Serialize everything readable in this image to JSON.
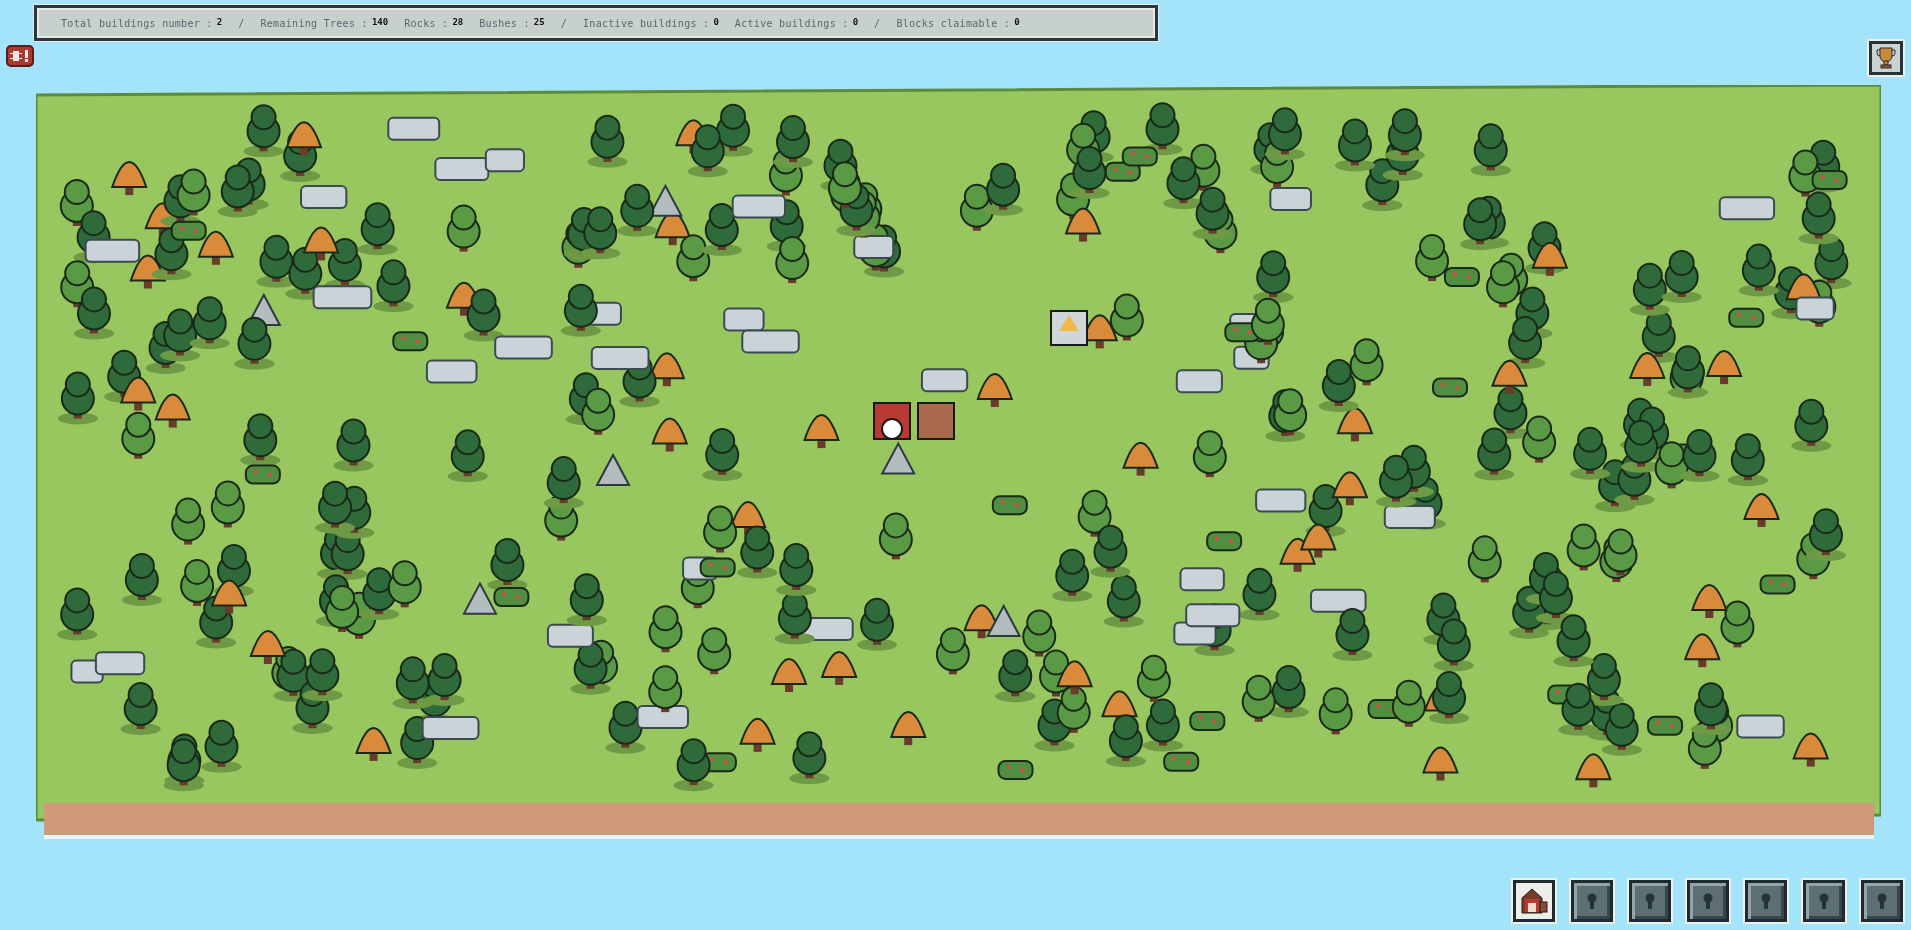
{
  "stats_bar": [
    {
      "label": "Total buildings number :",
      "value": "2"
    },
    {
      "label": "Remaining Trees :",
      "value": "140",
      "separator": "/"
    },
    {
      "label": "Rocks :",
      "value": "28"
    },
    {
      "label": "Bushes :",
      "value": "25"
    },
    {
      "label": "Inactive buildings :",
      "value": "0",
      "separator": "/"
    },
    {
      "label": "Active buildings :",
      "value": "0"
    },
    {
      "label": "Blocks claimable :",
      "value": "0",
      "separator": "/"
    }
  ],
  "build_slots": [
    {
      "kind": "building"
    },
    {
      "kind": "locked"
    },
    {
      "kind": "locked"
    },
    {
      "kind": "locked"
    },
    {
      "kind": "locked"
    },
    {
      "kind": "locked"
    },
    {
      "kind": "locked"
    }
  ]
}
